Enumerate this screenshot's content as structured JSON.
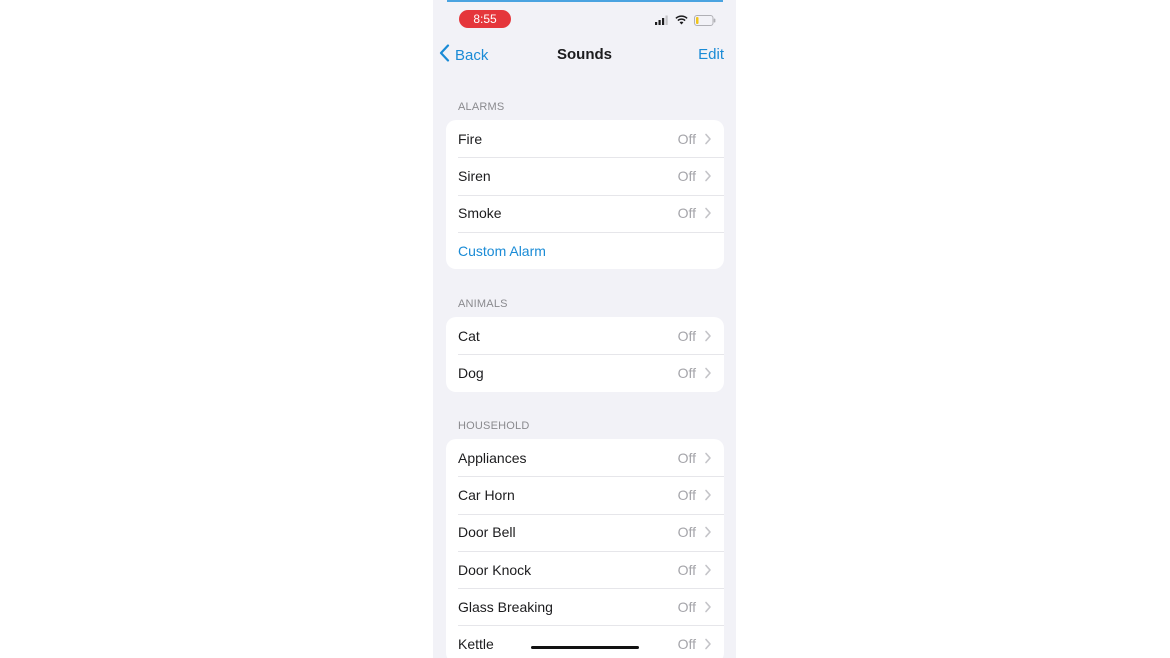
{
  "status_bar": {
    "time": "8:55"
  },
  "nav": {
    "back_label": "Back",
    "title": "Sounds",
    "edit_label": "Edit"
  },
  "sections": [
    {
      "header": "ALARMS",
      "rows": [
        {
          "label": "Fire",
          "value": "Off"
        },
        {
          "label": "Siren",
          "value": "Off"
        },
        {
          "label": "Smoke",
          "value": "Off"
        }
      ],
      "action": "Custom Alarm"
    },
    {
      "header": "ANIMALS",
      "rows": [
        {
          "label": "Cat",
          "value": "Off"
        },
        {
          "label": "Dog",
          "value": "Off"
        }
      ]
    },
    {
      "header": "HOUSEHOLD",
      "rows": [
        {
          "label": "Appliances",
          "value": "Off"
        },
        {
          "label": "Car Horn",
          "value": "Off"
        },
        {
          "label": "Door Bell",
          "value": "Off"
        },
        {
          "label": "Door Knock",
          "value": "Off"
        },
        {
          "label": "Glass Breaking",
          "value": "Off"
        },
        {
          "label": "Kettle",
          "value": "Off"
        }
      ]
    }
  ],
  "colors": {
    "accent": "#1a8bd6",
    "time_pill": "#e5363b",
    "background": "#f2f2f7"
  }
}
